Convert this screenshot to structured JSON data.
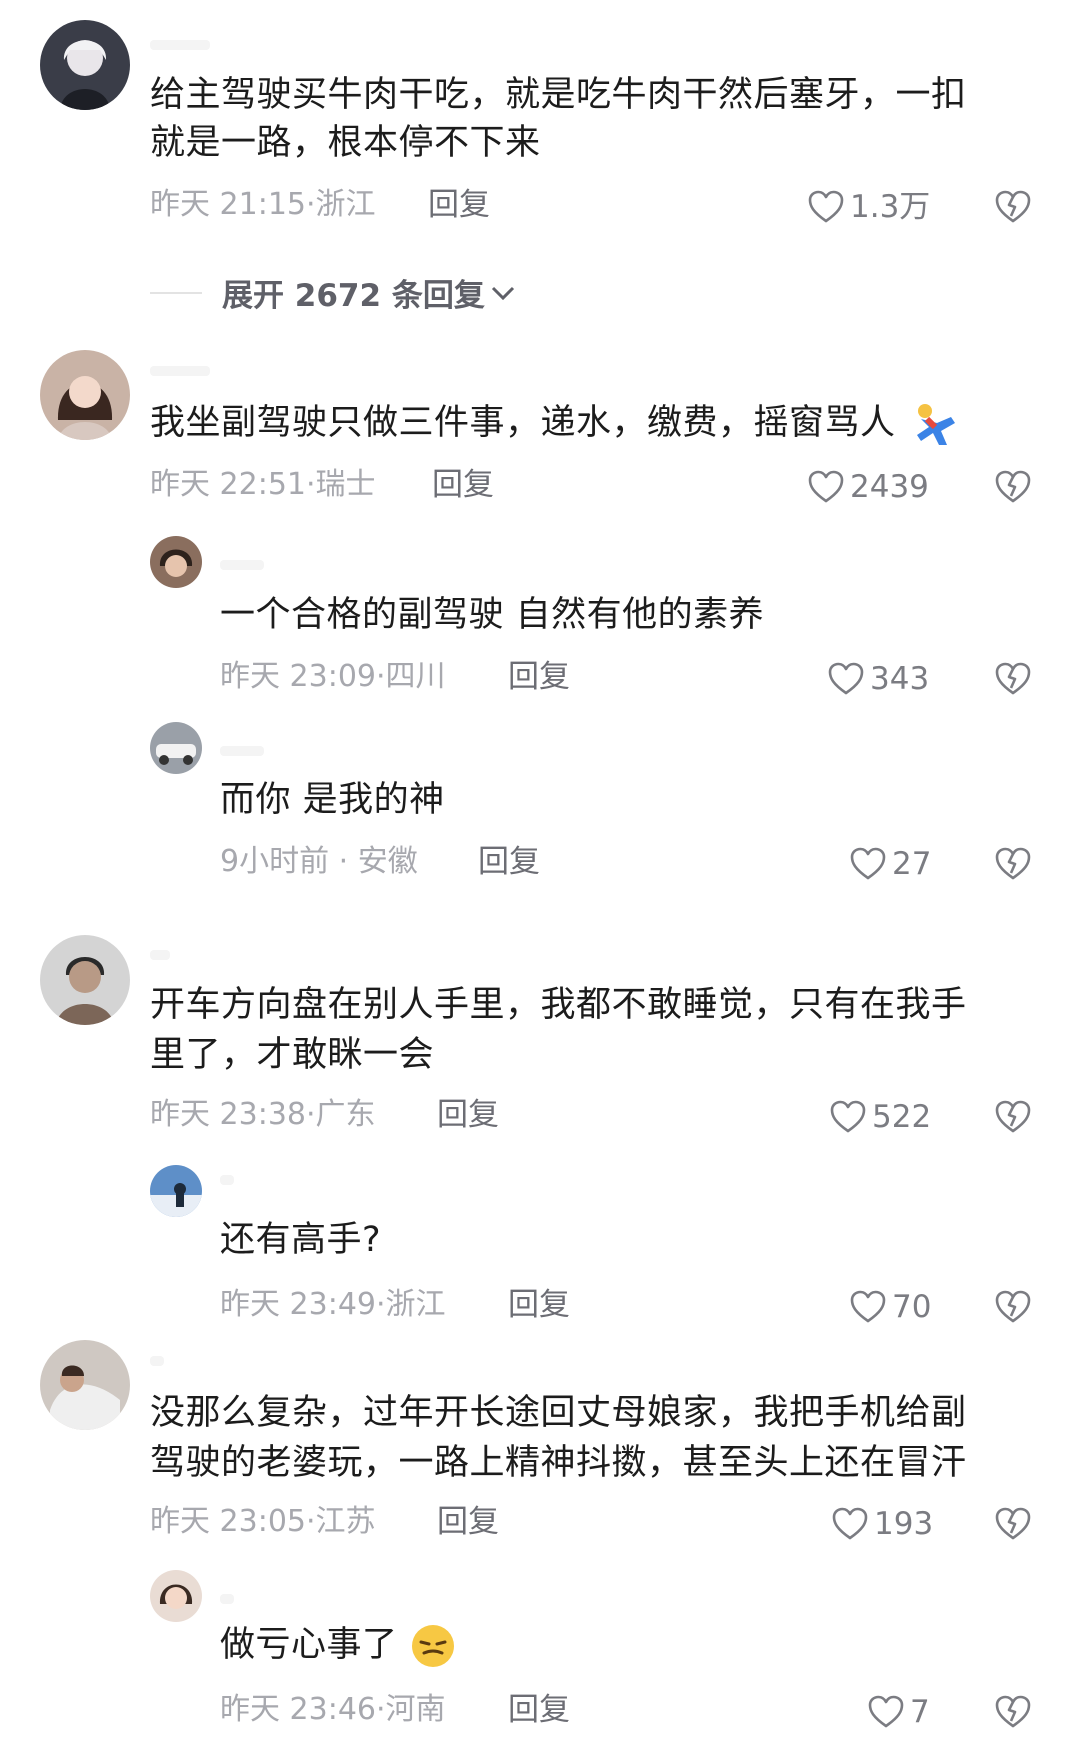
{
  "comments": [
    {
      "text_lines": [
        "给主驾驶买牛肉干吃，就是吃牛肉干然后塞牙，一扣",
        "就是一路，根本停不下来"
      ],
      "time": "昨天 21:15",
      "location": "浙江",
      "reply_label": "回复",
      "likes": "1.3万",
      "expand_label": "展开 2672 条回复"
    },
    {
      "text_lines": [
        "我坐副驾驶只做三件事，递水，缴费，摇窗骂人"
      ],
      "time": "昨天 22:51",
      "location": "瑞士",
      "reply_label": "回复",
      "likes": "2439",
      "replies": [
        {
          "text": "一个合格的副驾驶 自然有他的素养",
          "time": "昨天 23:09",
          "location": "四川",
          "reply_label": "回复",
          "likes": "343"
        },
        {
          "text": "而你 是我的神",
          "time": "9小时前",
          "location": "安徽",
          "reply_label": "回复",
          "likes": "27"
        }
      ]
    },
    {
      "text_lines": [
        "开车方向盘在别人手里，我都不敢睡觉，只有在我手",
        "里了，才敢眯一会"
      ],
      "time": "昨天 23:38",
      "location": "广东",
      "reply_label": "回复",
      "likes": "522",
      "replies": [
        {
          "text": "还有高手?",
          "time": "昨天 23:49",
          "location": "浙江",
          "reply_label": "回复",
          "likes": "70"
        }
      ]
    },
    {
      "text_lines": [
        "没那么复杂，过年开长途回丈母娘家，我把手机给副",
        "驾驶的老婆玩，一路上精神抖擞，甚至头上还在冒汗"
      ],
      "time": "昨天 23:05",
      "location": "江苏",
      "reply_label": "回复",
      "likes": "193",
      "replies": [
        {
          "text": "做亏心事了",
          "time": "昨天 23:46",
          "location": "河南",
          "reply_label": "回复",
          "likes": "7"
        }
      ]
    }
  ],
  "icons": {
    "like": "heart-outline-icon",
    "dislike": "broken-heart-icon",
    "expand": "chevron-down-icon"
  },
  "colors": {
    "text": "#1c1c1c",
    "meta": "#a7a8ae",
    "reply": "#6c6d74",
    "icon": "#7b7c82"
  }
}
